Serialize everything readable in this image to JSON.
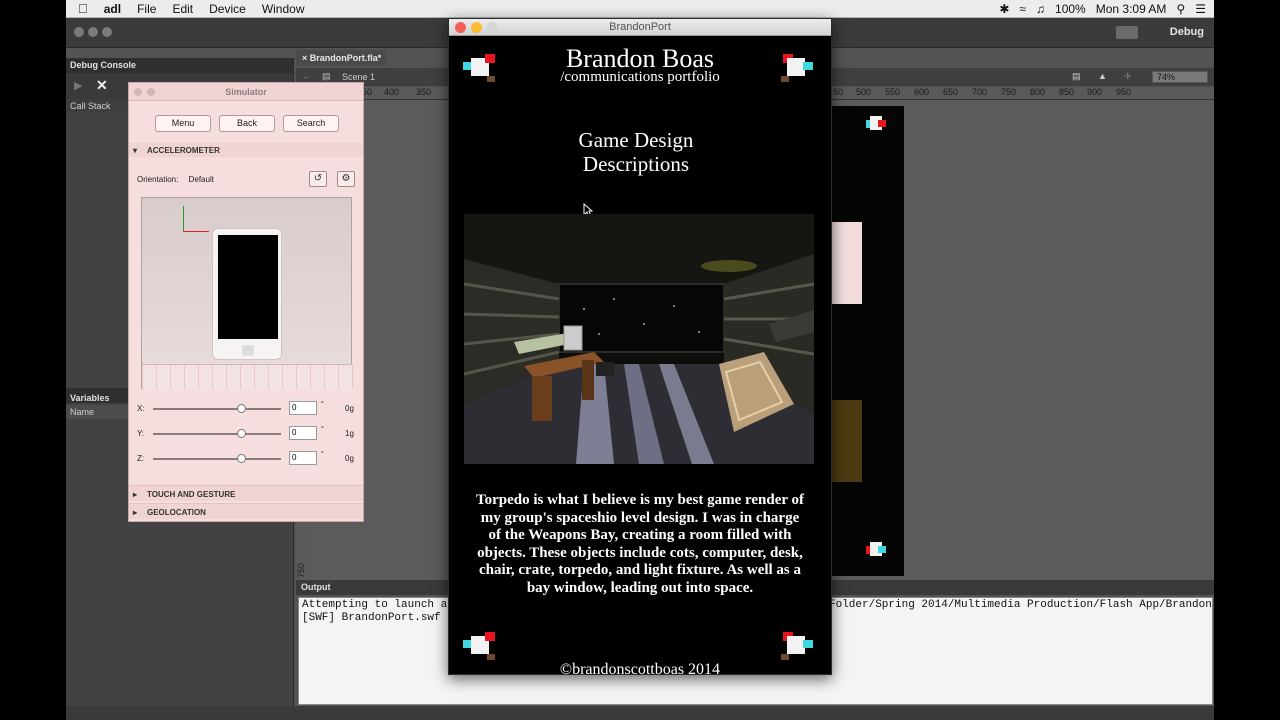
{
  "menubar": {
    "app_name": "adl",
    "items": [
      "File",
      "Edit",
      "Device",
      "Window"
    ],
    "clock": "Mon 3:09 AM",
    "battery": "100%"
  },
  "ide": {
    "workspace_label": "Debug",
    "document_tab": "BrandonPort.fla*",
    "scene_label": "Scene 1",
    "zoom": "74%",
    "ruler_ticks_left": [
      "50",
      "400",
      "350"
    ],
    "ruler_ticks_right": [
      "50",
      "500",
      "550",
      "600",
      "650",
      "700",
      "750",
      "800",
      "850",
      "900",
      "950"
    ],
    "vertical_ruler_label": "750"
  },
  "debug_console": {
    "title": "Debug Console",
    "call_stack_label": "Call Stack",
    "variables_title": "Variables",
    "variables_column": "Name"
  },
  "output": {
    "title": "Output",
    "lines": [
      "Attempting to launch ar",
      "[SWF] BrandonPort.swf -"
    ],
    "path_fragment": "Folder/Spring 2014/Multimedia Production/Flash App/Brandon"
  },
  "simulator": {
    "title": "Simulator",
    "buttons": [
      "Menu",
      "Back",
      "Search"
    ],
    "accelerometer_label": "ACCELEROMETER",
    "orientation_label": "Orientation:",
    "orientation_value": "Default",
    "axes": [
      {
        "name": "X:",
        "value": "0",
        "g": "0g"
      },
      {
        "name": "Y:",
        "value": "0",
        "g": "1g"
      },
      {
        "name": "Z:",
        "value": "0",
        "g": "0g"
      }
    ],
    "degree_symbol": "°",
    "touch_label": "TOUCH AND GESTURE",
    "geolocation_label": "GEOLOCATION"
  },
  "app_window": {
    "title": "BrandonPort",
    "site_name": "Brandon Boas",
    "site_subtitle": "/communications portfolio",
    "section_title": "Game Design Descriptions",
    "description": "Torpedo is what I believe is my best game render of my group's spaceshio level design. I was in charge of the Weapons Bay, creating a room filled with objects. These objects include cots, computer, desk, chair, crate, torpedo, and light fixture. As well as a bay window, leading out into space.",
    "copyright": "©brandonscottboas 2014"
  },
  "colors": {
    "logo_red": "#e8141e",
    "logo_cyan": "#3fd7e0",
    "logo_white": "#f2f2f2",
    "simulator_bg": "#f5dedd",
    "ide_gray": "#535353"
  }
}
